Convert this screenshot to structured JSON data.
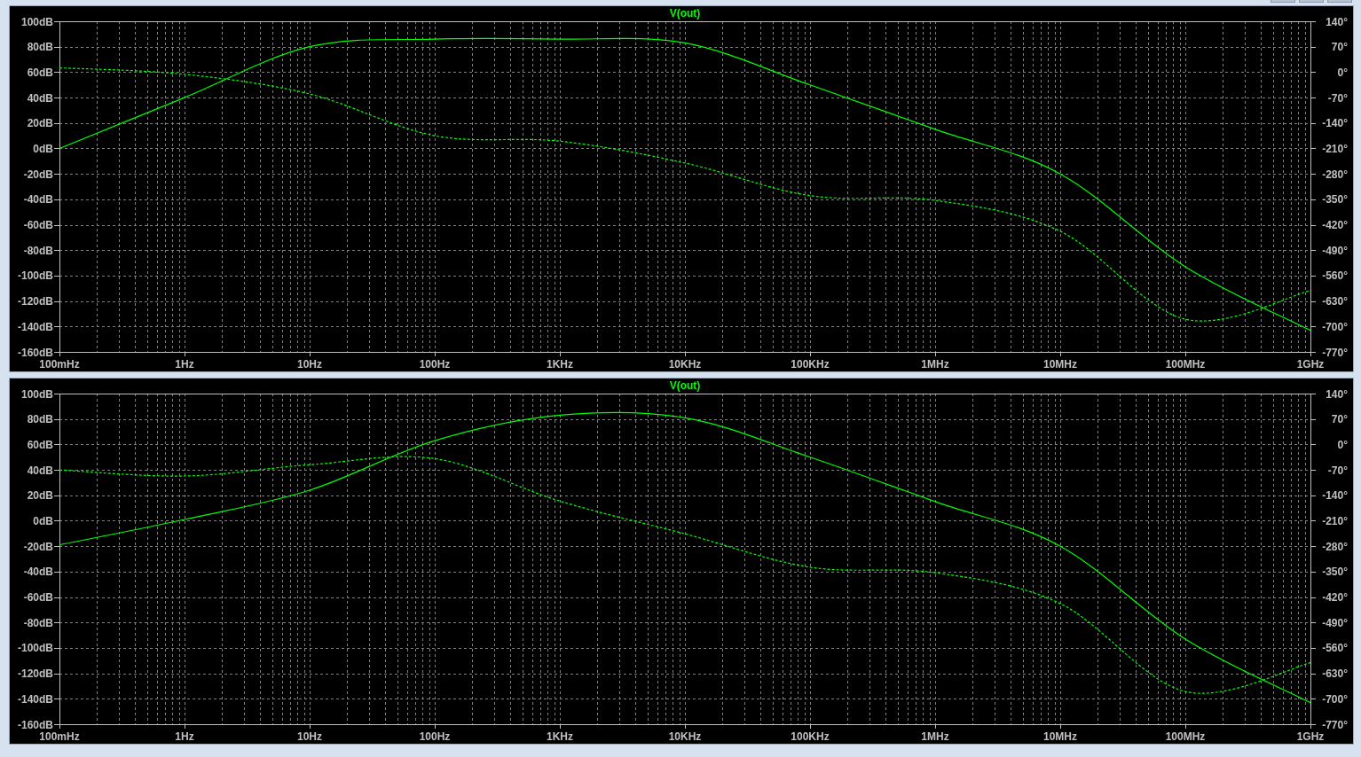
{
  "panes": [
    {
      "title": "V(out)",
      "chart_data": {
        "type": "line",
        "grid": true,
        "categories": [
          "100mHz",
          "1Hz",
          "10Hz",
          "100Hz",
          "1KHz",
          "10KHz",
          "100KHz",
          "1MHz",
          "10MHz",
          "100MHz",
          "1GHz"
        ],
        "ylim": [
          -160,
          100
        ],
        "y2lim": [
          -770,
          140
        ],
        "yticks": [
          {
            "value": 100,
            "label": "100dB"
          },
          {
            "value": 80,
            "label": "80dB"
          },
          {
            "value": 60,
            "label": "60dB"
          },
          {
            "value": 40,
            "label": "40dB"
          },
          {
            "value": 20,
            "label": "20dB"
          },
          {
            "value": 0,
            "label": "0dB"
          },
          {
            "value": -20,
            "label": "-20dB"
          },
          {
            "value": -40,
            "label": "-40dB"
          },
          {
            "value": -60,
            "label": "-60dB"
          },
          {
            "value": -80,
            "label": "-80dB"
          },
          {
            "value": -100,
            "label": "-100dB"
          },
          {
            "value": -120,
            "label": "-120dB"
          },
          {
            "value": -140,
            "label": "-140dB"
          },
          {
            "value": -160,
            "label": "-160dB"
          }
        ],
        "y2ticks": [
          {
            "value": 140,
            "label": "140°"
          },
          {
            "value": 70,
            "label": "70°"
          },
          {
            "value": 0,
            "label": "0°"
          },
          {
            "value": -70,
            "label": "-70°"
          },
          {
            "value": -140,
            "label": "-140°"
          },
          {
            "value": -210,
            "label": "-210°"
          },
          {
            "value": -280,
            "label": "-280°"
          },
          {
            "value": -350,
            "label": "-350°"
          },
          {
            "value": -420,
            "label": "-420°"
          },
          {
            "value": -490,
            "label": "-490°"
          },
          {
            "value": -560,
            "label": "-560°"
          },
          {
            "value": -630,
            "label": "-630°"
          },
          {
            "value": -700,
            "label": "-700°"
          },
          {
            "value": -770,
            "label": "-770°"
          }
        ],
        "series": [
          {
            "color": "#00ff00",
            "values": [
              0,
              40,
              80,
              86,
              86,
              83,
              50,
              15,
              -20,
              -93,
              -143
            ]
          },
          {
            "color": "#00ff00",
            "axis": "y2",
            "line_style": "dashed",
            "values": [
              12,
              -6,
              -60,
              -175,
              -190,
              -250,
              -340,
              -353,
              -438,
              -680,
              -601
            ]
          }
        ]
      }
    },
    {
      "title": "V(out)",
      "chart_data": {
        "type": "line",
        "grid": true,
        "categories": [
          "100mHz",
          "1Hz",
          "10Hz",
          "100Hz",
          "1KHz",
          "10KHz",
          "100KHz",
          "1MHz",
          "10MHz",
          "100MHz",
          "1GHz"
        ],
        "ylim": [
          -160,
          100
        ],
        "y2lim": [
          -770,
          140
        ],
        "yticks": [
          {
            "value": 100,
            "label": "100dB"
          },
          {
            "value": 80,
            "label": "80dB"
          },
          {
            "value": 60,
            "label": "60dB"
          },
          {
            "value": 40,
            "label": "40dB"
          },
          {
            "value": 20,
            "label": "20dB"
          },
          {
            "value": 0,
            "label": "0dB"
          },
          {
            "value": -20,
            "label": "-20dB"
          },
          {
            "value": -40,
            "label": "-40dB"
          },
          {
            "value": -60,
            "label": "-60dB"
          },
          {
            "value": -80,
            "label": "-80dB"
          },
          {
            "value": -100,
            "label": "-100dB"
          },
          {
            "value": -120,
            "label": "-120dB"
          },
          {
            "value": -140,
            "label": "-140dB"
          },
          {
            "value": -160,
            "label": "-160dB"
          }
        ],
        "y2ticks": [
          {
            "value": 140,
            "label": "140°"
          },
          {
            "value": 70,
            "label": "70°"
          },
          {
            "value": 0,
            "label": "0°"
          },
          {
            "value": -70,
            "label": "-70°"
          },
          {
            "value": -140,
            "label": "-140°"
          },
          {
            "value": -210,
            "label": "-210°"
          },
          {
            "value": -280,
            "label": "-280°"
          },
          {
            "value": -350,
            "label": "-350°"
          },
          {
            "value": -420,
            "label": "-420°"
          },
          {
            "value": -490,
            "label": "-490°"
          },
          {
            "value": -560,
            "label": "-560°"
          },
          {
            "value": -630,
            "label": "-630°"
          },
          {
            "value": -700,
            "label": "-700°"
          },
          {
            "value": -770,
            "label": "-770°"
          }
        ],
        "series": [
          {
            "color": "#00ff00",
            "values": [
              -19,
              1,
              24,
              63,
              83,
              81,
              50,
              15,
              -20,
              -93,
              -143
            ]
          },
          {
            "color": "#00ff00",
            "axis": "y2",
            "line_style": "dashed",
            "values": [
              -70,
              -87,
              -56,
              -39,
              -156,
              -246,
              -338,
              -353,
              -438,
              -680,
              -601
            ]
          }
        ]
      }
    }
  ]
}
